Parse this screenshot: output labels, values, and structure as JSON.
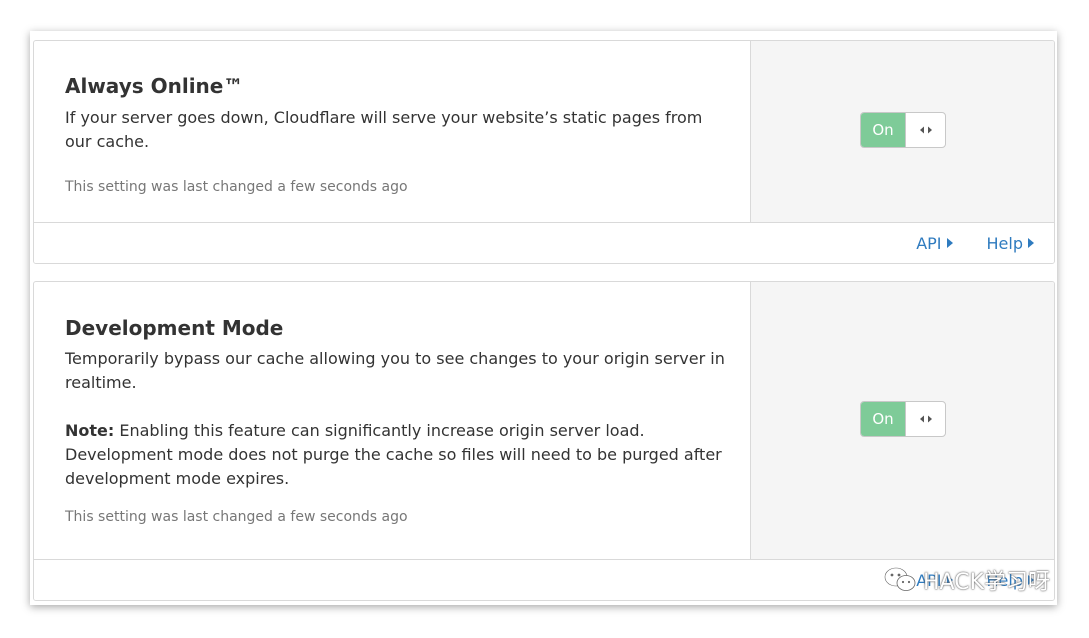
{
  "cards": [
    {
      "title": "Always Online™",
      "description": "If your server goes down, Cloudflare will serve your website’s static pages from our cache.",
      "meta": "This setting was last changed a few seconds ago",
      "toggle": {
        "label": "On",
        "state": "on"
      },
      "links": {
        "api": "API",
        "help": "Help"
      }
    },
    {
      "title": "Development Mode",
      "description": "Temporarily bypass our cache allowing you to see changes to your origin server in realtime.",
      "note_label": "Note:",
      "note_text": " Enabling this feature can significantly increase origin server load. Development mode does not purge the cache so files will need to be purged after development mode expires.",
      "meta": "This setting was last changed a few seconds ago",
      "toggle": {
        "label": "On",
        "state": "on"
      },
      "links": {
        "api": "API",
        "help": "Help"
      }
    }
  ],
  "watermark": {
    "text": "HACK学习呀",
    "icon": "wechat-icon"
  },
  "colors": {
    "toggle_on": "#7ecb98",
    "link": "#2f7bbf",
    "control_panel_bg": "#f5f5f5"
  }
}
